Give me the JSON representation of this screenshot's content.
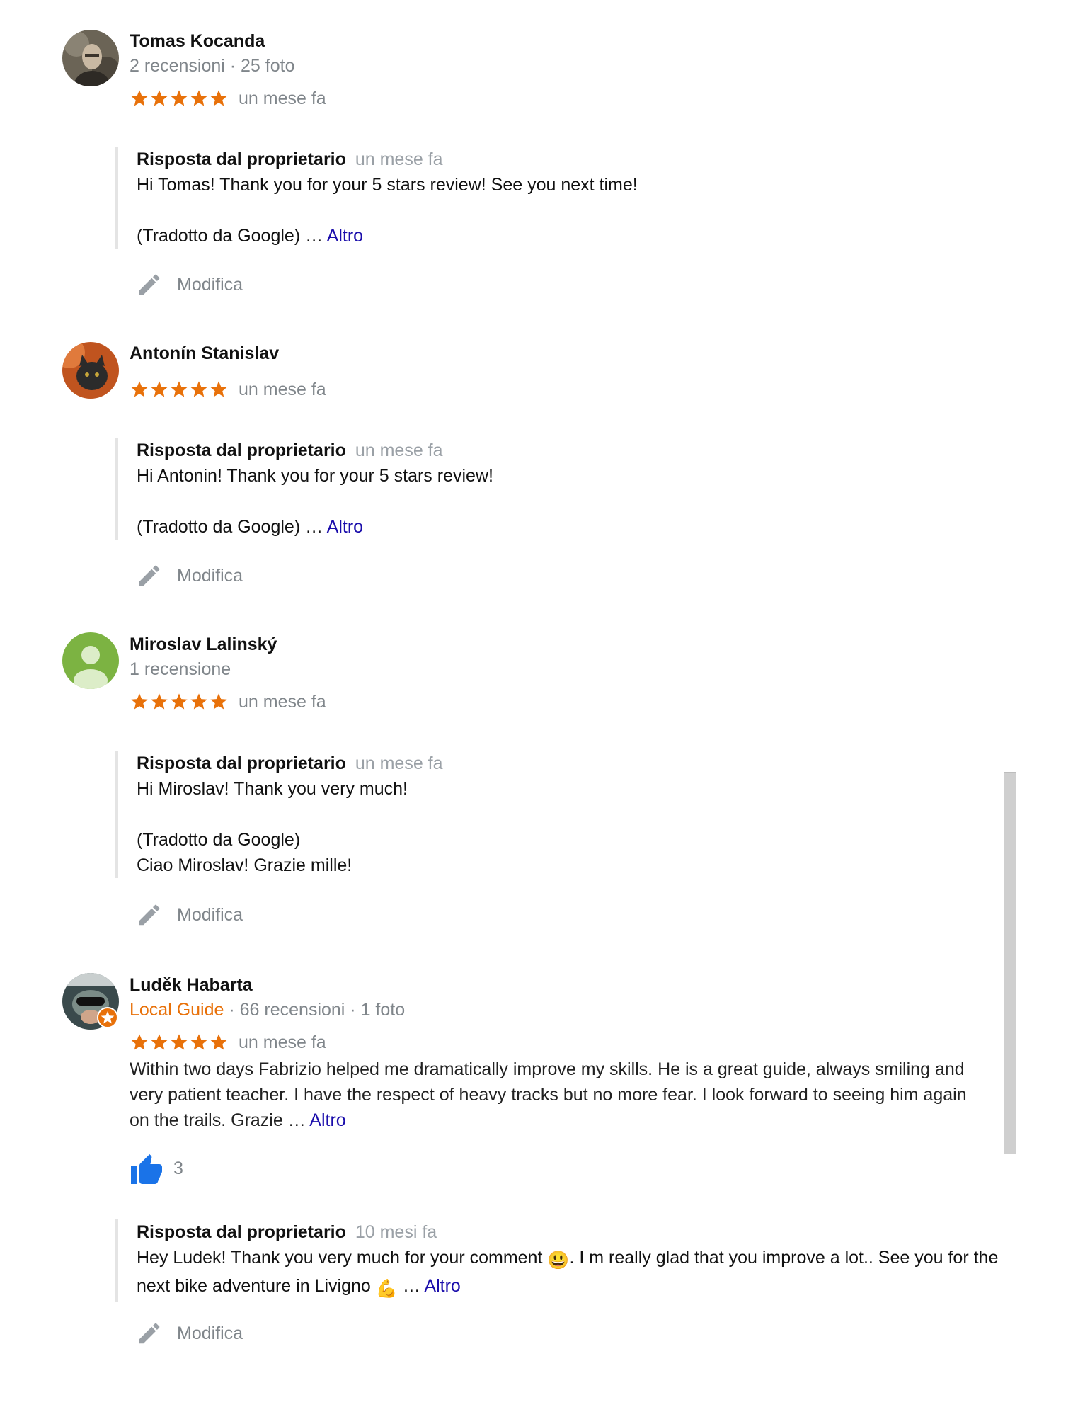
{
  "colors": {
    "star": "#e8710a",
    "link": "#1a0dab",
    "guide": "#e8710a",
    "like": "#1a73e8"
  },
  "reviews": [
    {
      "author": "Tomas Kocanda",
      "meta": "2 recensioni · 25 foto",
      "rating": 5,
      "date": "un mese fa",
      "reply": {
        "owner_label": "Risposta dal proprietario",
        "date": "un mese fa",
        "line1": "Hi Tomas! Thank you for your 5 stars review! See you next time!",
        "line2": "(Tradotto da Google) … ",
        "more": "Altro"
      },
      "edit_label": "Modifica"
    },
    {
      "author": "Antonín Stanislav",
      "rating": 5,
      "date": "un mese fa",
      "reply": {
        "owner_label": "Risposta dal proprietario",
        "date": "un mese fa",
        "line1": "Hi Antonin! Thank you for your 5 stars review!",
        "line2": "(Tradotto da Google) … ",
        "more": "Altro"
      },
      "edit_label": "Modifica"
    },
    {
      "author": "Miroslav Lalinský",
      "meta": "1 recensione",
      "rating": 5,
      "date": "un mese fa",
      "reply": {
        "owner_label": "Risposta dal proprietario",
        "date": "un mese fa",
        "line1": "Hi Miroslav! Thank you very much!",
        "line2": "(Tradotto da Google)",
        "line3": "Ciao Miroslav! Grazie mille!"
      },
      "edit_label": "Modifica"
    },
    {
      "author": "Luděk Habarta",
      "guide_label": "Local Guide",
      "meta": " · 66 recensioni · 1 foto",
      "rating": 5,
      "date": "un mese fa",
      "text": "Within two days Fabrizio helped me dramatically improve my skills. He is a great guide, always smiling and very patient teacher. I have the respect of heavy tracks but no more fear. I look forward to seeing him again on the trails. Grazie … ",
      "more": "Altro",
      "likes": "3",
      "reply": {
        "owner_label": "Risposta dal proprietario",
        "date": "10 mesi fa",
        "part1": "Hey Ludek! Thank you very much for your comment ",
        "emoji1": "😃",
        "part2": ". I m really glad that you improve a lot.. See you for the next bike adventure in Livigno ",
        "emoji2": "💪",
        "part3": " … ",
        "more": "Altro"
      },
      "edit_label": "Modifica"
    }
  ]
}
